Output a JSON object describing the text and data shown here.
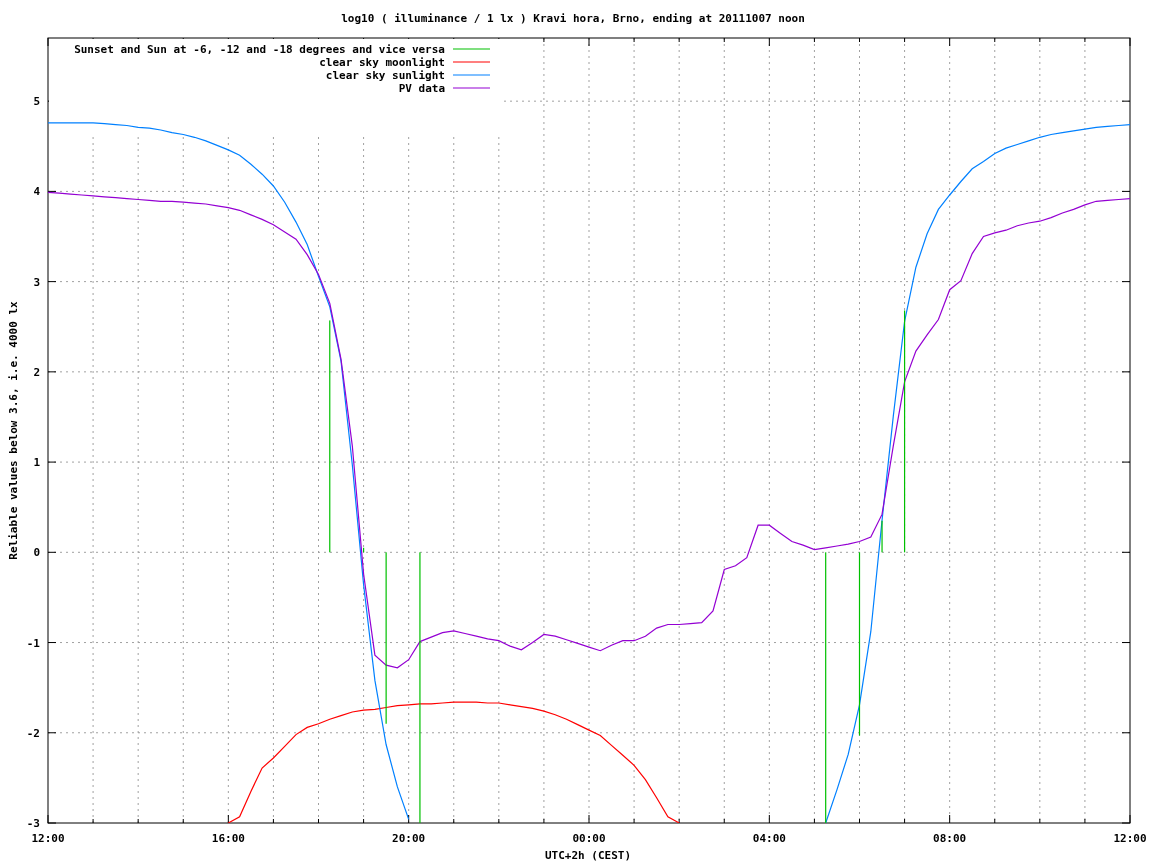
{
  "chart": {
    "chart_data": {
      "type": "line",
      "title": "log10 ( illuminance / 1 lx ) Kravi hora, Brno, ending at 20111007 noon",
      "xlabel": "UTC+2h (CEST)",
      "ylabel": "Reliable values below 3.6, i.e. 4000 lx",
      "ylim": [
        -3,
        5.7
      ],
      "yticks": [
        -3,
        -2,
        -1,
        0,
        1,
        2,
        3,
        4,
        5
      ],
      "categories": [
        "12:00",
        null,
        null,
        null,
        null,
        null,
        null,
        null,
        null,
        null,
        null,
        null,
        null,
        null,
        null,
        null,
        "16:00",
        null,
        null,
        null,
        null,
        null,
        null,
        null,
        null,
        null,
        null,
        null,
        null,
        null,
        null,
        null,
        "20:00",
        null,
        null,
        null,
        null,
        null,
        null,
        null,
        null,
        null,
        null,
        null,
        null,
        null,
        null,
        null,
        "00:00",
        null,
        null,
        null,
        null,
        null,
        null,
        null,
        null,
        null,
        null,
        null,
        null,
        null,
        null,
        null,
        "04:00",
        null,
        null,
        null,
        null,
        null,
        null,
        null,
        null,
        null,
        null,
        null,
        null,
        null,
        null,
        null,
        "08:00",
        null,
        null,
        null,
        null,
        null,
        null,
        null,
        null,
        null,
        null,
        null,
        null,
        null,
        null,
        null,
        "12:00"
      ],
      "grid": true,
      "legend": "upper left",
      "series": [
        {
          "name": "Sunset and Sun at -6, -12 and -18 degrees and vice versa",
          "color": "#00c000",
          "type": "bar",
          "values": [
            null,
            null,
            null,
            null,
            null,
            null,
            null,
            null,
            null,
            null,
            null,
            null,
            null,
            null,
            null,
            null,
            null,
            null,
            null,
            null,
            null,
            null,
            null,
            null,
            null,
            2.57,
            null,
            null,
            0.05,
            null,
            -1.9,
            null,
            null,
            -3,
            null,
            null,
            null,
            null,
            null,
            null,
            null,
            null,
            null,
            null,
            null,
            null,
            null,
            null,
            null,
            null,
            null,
            null,
            null,
            null,
            null,
            null,
            null,
            null,
            null,
            null,
            null,
            null,
            null,
            null,
            null,
            null,
            null,
            null,
            null,
            -3,
            null,
            null,
            -2.03,
            null,
            0.35,
            null,
            2.68,
            null,
            null,
            null,
            null,
            null,
            null,
            null,
            null,
            null,
            null,
            null,
            null,
            null,
            null,
            null,
            null,
            null,
            null,
            null,
            null
          ]
        },
        {
          "name": "clear sky moonlight",
          "color": "#ff0000",
          "values": [
            null,
            null,
            null,
            null,
            null,
            null,
            null,
            null,
            null,
            null,
            null,
            null,
            null,
            null,
            null,
            null,
            -3.0,
            -2.93,
            -2.65,
            -2.39,
            -2.28,
            -2.15,
            -2.02,
            -1.94,
            -1.9,
            -1.85,
            -1.81,
            -1.77,
            -1.75,
            -1.74,
            -1.72,
            -1.7,
            -1.69,
            -1.68,
            -1.68,
            -1.67,
            -1.66,
            -1.66,
            -1.66,
            -1.67,
            -1.67,
            -1.69,
            -1.71,
            -1.73,
            -1.76,
            -1.8,
            -1.85,
            -1.91,
            -1.97,
            -2.03,
            -2.14,
            -2.25,
            -2.36,
            -2.52,
            -2.72,
            -2.93,
            -3.0,
            null,
            null,
            null,
            null,
            null,
            null,
            null,
            null,
            null,
            null,
            null,
            null,
            null,
            null,
            null,
            null,
            null,
            null,
            null,
            null,
            null,
            null,
            null,
            null,
            null,
            null,
            null,
            null,
            null,
            null,
            null,
            null,
            null,
            null,
            null,
            null,
            null,
            null,
            null,
            null
          ]
        },
        {
          "name": "clear sky sunlight",
          "color": "#0080ff",
          "values": [
            4.76,
            4.76,
            4.76,
            4.76,
            4.76,
            4.75,
            4.74,
            4.73,
            4.71,
            4.7,
            4.68,
            4.65,
            4.63,
            4.6,
            4.56,
            4.51,
            4.46,
            4.4,
            4.3,
            4.19,
            4.06,
            3.88,
            3.66,
            3.41,
            3.06,
            2.72,
            2.12,
            0.97,
            -0.36,
            -1.42,
            -2.13,
            -2.6,
            -2.96,
            null,
            null,
            null,
            null,
            null,
            null,
            null,
            null,
            null,
            null,
            null,
            null,
            null,
            null,
            null,
            null,
            null,
            null,
            null,
            null,
            null,
            null,
            null,
            null,
            null,
            null,
            null,
            null,
            null,
            null,
            null,
            null,
            null,
            null,
            null,
            null,
            -3.0,
            -2.63,
            -2.24,
            -1.69,
            -0.88,
            0.35,
            1.51,
            2.56,
            3.16,
            3.53,
            3.8,
            3.96,
            4.11,
            4.25,
            4.33,
            4.42,
            4.48,
            4.52,
            4.56,
            4.6,
            4.63,
            4.65,
            4.67,
            4.69,
            4.71,
            4.72,
            4.73,
            4.74
          ]
        },
        {
          "name": "PV data",
          "color": "#9400d3",
          "values": [
            3.99,
            3.98,
            3.97,
            3.96,
            3.95,
            3.94,
            3.93,
            3.92,
            3.91,
            3.9,
            3.89,
            3.89,
            3.88,
            3.87,
            3.86,
            3.84,
            3.82,
            3.79,
            3.74,
            3.69,
            3.63,
            3.55,
            3.47,
            3.3,
            3.08,
            2.76,
            2.14,
            1.18,
            -0.24,
            -1.14,
            -1.25,
            -1.28,
            -1.19,
            -0.99,
            -0.94,
            -0.89,
            -0.87,
            -0.9,
            -0.93,
            -0.96,
            -0.98,
            -1.04,
            -1.08,
            -1.0,
            -0.91,
            -0.93,
            -0.97,
            -1.01,
            -1.05,
            -1.09,
            -1.03,
            -0.98,
            -0.98,
            -0.93,
            -0.84,
            -0.8,
            -0.8,
            -0.79,
            -0.78,
            -0.65,
            -0.19,
            -0.15,
            -0.06,
            0.3,
            0.3,
            0.21,
            0.12,
            0.08,
            0.03,
            0.05,
            0.07,
            0.09,
            0.12,
            0.17,
            0.42,
            1.18,
            1.89,
            2.23,
            2.41,
            2.58,
            2.91,
            3.01,
            3.31,
            3.5,
            3.54,
            3.57,
            3.62,
            3.65,
            3.67,
            3.71,
            3.76,
            3.8,
            3.85,
            3.89,
            3.9,
            3.91,
            3.92
          ]
        }
      ]
    }
  }
}
